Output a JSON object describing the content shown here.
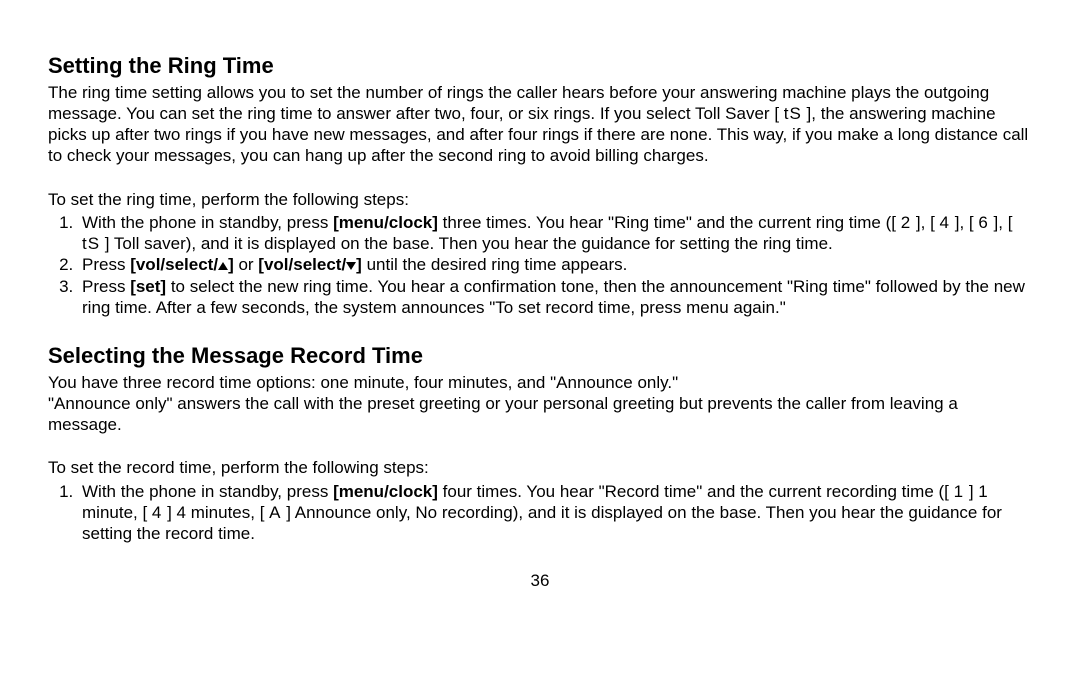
{
  "section1": {
    "heading": "Setting the Ring Time",
    "intro_a": "The ring time setting allows you to set the number of rings the caller hears before your answering machine plays the outgoing message. You can set the ring time to answer after two, four, or six rings. If you select Toll Saver [ ",
    "ts_glyph": "tS",
    "intro_b": " ], the answering machine picks up after two rings if you have new messages, and after four rings if there are none. This way, if you make a long distance call to check your messages, you can hang up after the second ring to avoid billing charges.",
    "lead": "To set the ring time, perform the following steps:",
    "step1_a": "With the phone in standby, press ",
    "menu_clock": "[menu/clock]",
    "step1_b": " three times. You hear \"Ring time\" and the current ring time ([ ",
    "g2": "2",
    "step1_c": " ], [ ",
    "g4": "4",
    "step1_d": " ], [ ",
    "g6": "6",
    "step1_e": " ], [ ",
    "gts": "tS",
    "step1_f": " ] Toll saver), and it is displayed on the base. Then you hear the guidance for setting the ring time.",
    "step2_a": "Press ",
    "vol_up_a": "[vol/select/",
    "vol_up_b": "]",
    "step2_or": " or ",
    "vol_dn_a": "[vol/select/",
    "vol_dn_b": "]",
    "step2_b": " until the desired ring time appears.",
    "step3_a": "Press ",
    "set_btn": "[set]",
    "step3_b": " to select the new ring time. You hear a confirmation tone, then the announcement \"Ring time\" followed by the new ring time. After a few seconds, the system announces \"To set record time, press menu again.\""
  },
  "section2": {
    "heading": "Selecting the Message Record Time",
    "line1": "You have three record time options: one minute, four minutes, and \"Announce only.\"",
    "line2": "\"Announce only\" answers the call with the preset greeting or your personal greeting but prevents the caller from leaving a message.",
    "lead": "To set the record time, perform the following steps:",
    "step1_a": "With the phone in standby, press ",
    "menu_clock": "[menu/clock]",
    "step1_b": " four times. You hear \"Record time\" and the current recording time ([ ",
    "g1": "1",
    "step1_c": " ] 1 minute, [ ",
    "g4": "4",
    "step1_d": " ] 4 minutes, [ ",
    "gA": "A",
    "step1_e": " ] Announce only, No recording), and it is displayed on the base. Then you hear the guidance for setting the record time."
  },
  "page_number": "36"
}
